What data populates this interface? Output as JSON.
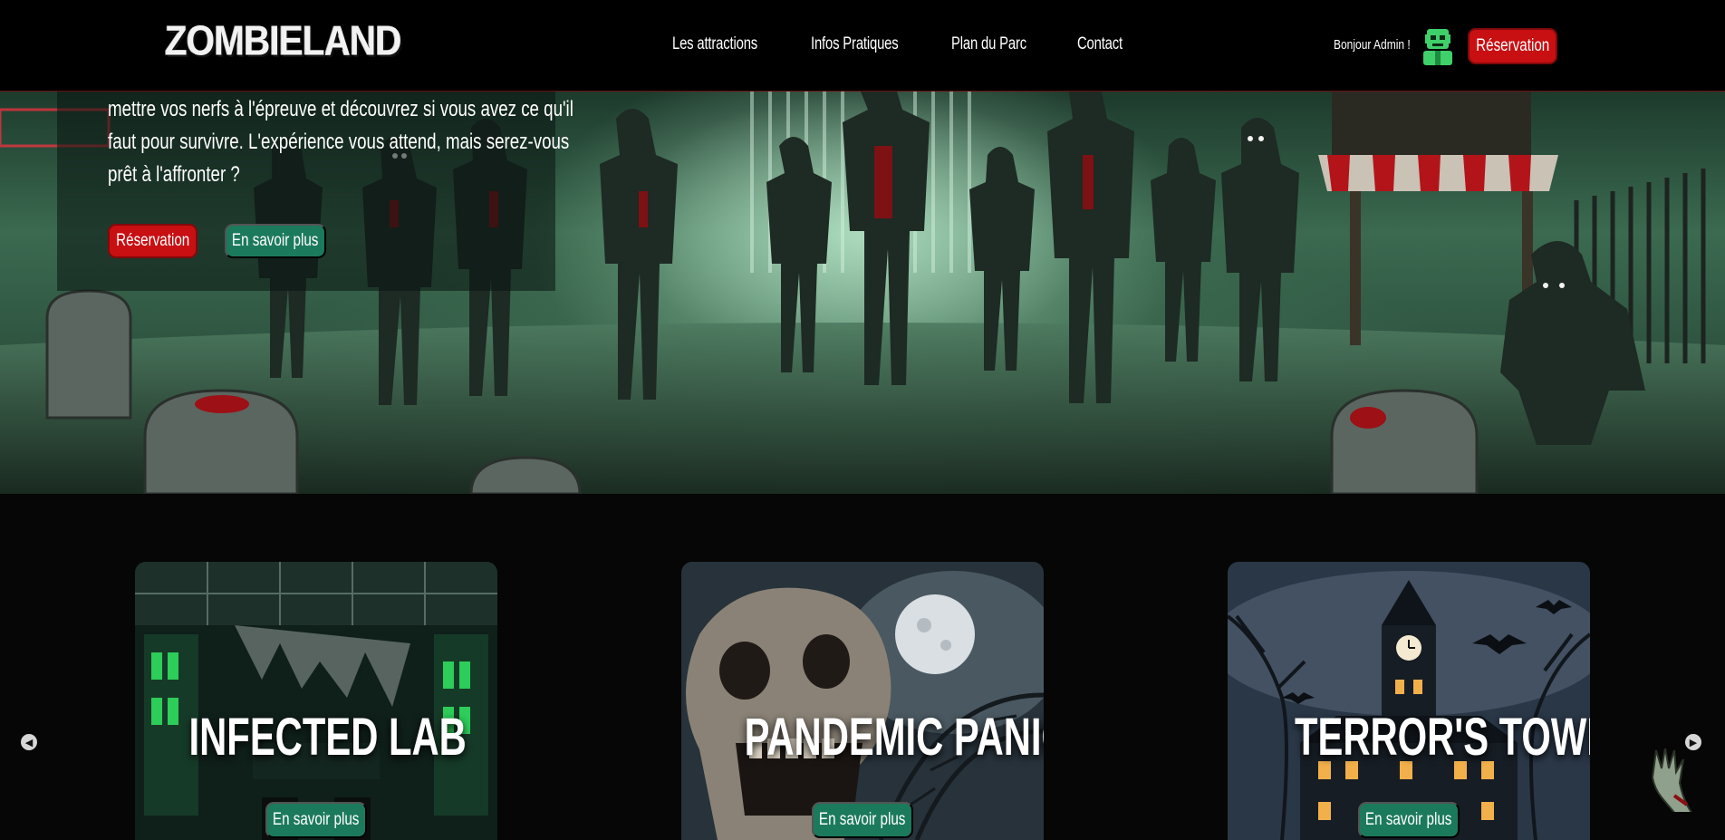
{
  "header": {
    "logo": "ZOMBIELAND",
    "nav": [
      "Les attractions",
      "Infos Pratiques",
      "Plan du Parc",
      "Contact"
    ],
    "greeting": "Bonjour Admin !",
    "reservation_label": "Réservation"
  },
  "hero": {
    "text": "mettre vos nerfs à l'épreuve et découvrez si vous avez ce qu'il faut pour survivre. L'expérience vous attend, mais serez-vous prêt à l'affronter ?",
    "reservation_label": "Réservation",
    "more_label": "En savoir plus"
  },
  "attractions": [
    {
      "title": "INFECTED LAB",
      "button": "En savoir plus"
    },
    {
      "title": "PANDEMIC PANIC",
      "button": "En savoir plus"
    },
    {
      "title": "TERROR'S TOWER",
      "button": "En savoir plus"
    }
  ],
  "carousel": {
    "prev_icon": "chevron-left-icon",
    "next_icon": "chevron-right-icon"
  },
  "colors": {
    "accent_red": "#c80f12",
    "accent_green": "#1c7a5c",
    "background": "#050505"
  }
}
